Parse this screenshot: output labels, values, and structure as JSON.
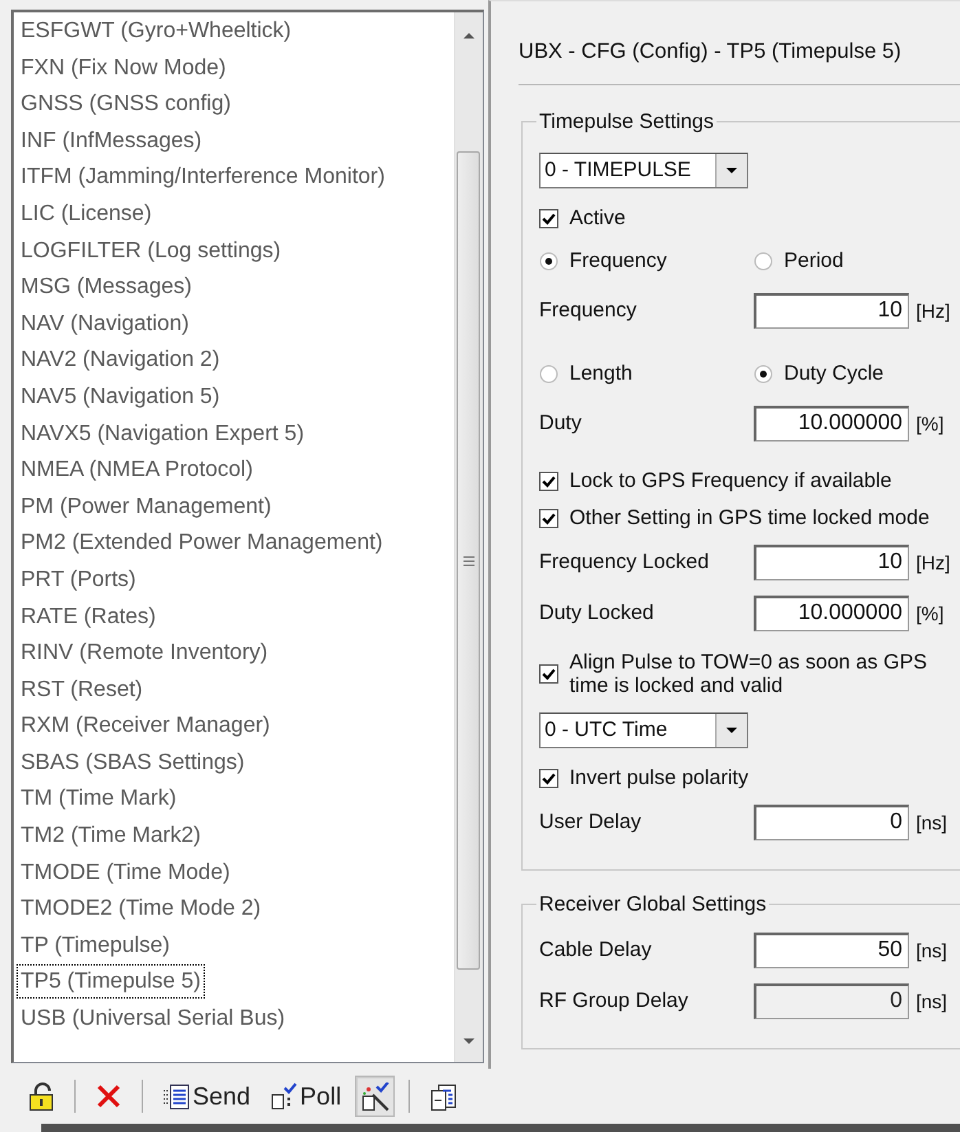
{
  "message_list": {
    "items": [
      {
        "label": "ESFGWT (Gyro+Wheeltick)",
        "selected": false
      },
      {
        "label": "FXN (Fix Now Mode)",
        "selected": false
      },
      {
        "label": "GNSS (GNSS config)",
        "selected": false
      },
      {
        "label": "INF (InfMessages)",
        "selected": false
      },
      {
        "label": "ITFM (Jamming/Interference Monitor)",
        "selected": false
      },
      {
        "label": "LIC (License)",
        "selected": false
      },
      {
        "label": "LOGFILTER (Log settings)",
        "selected": false
      },
      {
        "label": "MSG (Messages)",
        "selected": false
      },
      {
        "label": "NAV (Navigation)",
        "selected": false
      },
      {
        "label": "NAV2 (Navigation 2)",
        "selected": false
      },
      {
        "label": "NAV5 (Navigation 5)",
        "selected": false
      },
      {
        "label": "NAVX5 (Navigation Expert 5)",
        "selected": false
      },
      {
        "label": "NMEA (NMEA Protocol)",
        "selected": false
      },
      {
        "label": "PM (Power Management)",
        "selected": false
      },
      {
        "label": "PM2 (Extended Power Management)",
        "selected": false
      },
      {
        "label": "PRT (Ports)",
        "selected": false
      },
      {
        "label": "RATE (Rates)",
        "selected": false
      },
      {
        "label": "RINV (Remote Inventory)",
        "selected": false
      },
      {
        "label": "RST (Reset)",
        "selected": false
      },
      {
        "label": "RXM (Receiver Manager)",
        "selected": false
      },
      {
        "label": "SBAS (SBAS Settings)",
        "selected": false
      },
      {
        "label": "TM (Time Mark)",
        "selected": false
      },
      {
        "label": "TM2 (Time Mark2)",
        "selected": false
      },
      {
        "label": "TMODE (Time Mode)",
        "selected": false
      },
      {
        "label": "TMODE2 (Time Mode 2)",
        "selected": false
      },
      {
        "label": "TP (Timepulse)",
        "selected": false
      },
      {
        "label": "TP5 (Timepulse 5)",
        "selected": true
      },
      {
        "label": "USB (Universal Serial Bus)",
        "selected": false
      }
    ]
  },
  "toolbar": {
    "buttons": [
      {
        "kind": "lock",
        "pressed": false
      },
      {
        "kind": "separator"
      },
      {
        "kind": "delete",
        "pressed": false
      },
      {
        "kind": "separator"
      },
      {
        "kind": "send",
        "label": "Send",
        "pressed": false
      },
      {
        "kind": "poll",
        "label": "Poll",
        "pressed": false
      },
      {
        "kind": "autopoll",
        "pressed": true
      },
      {
        "kind": "separator"
      },
      {
        "kind": "export",
        "pressed": false
      }
    ]
  },
  "panel": {
    "title": "UBX - CFG (Config) - TP5 (Timepulse 5)",
    "groups": [
      {
        "title": "Timepulse Settings",
        "rows": [
          {
            "kind": "select",
            "value": "0 - TIMEPULSE"
          },
          {
            "kind": "check",
            "label": "Active",
            "checked": true
          },
          {
            "kind": "radios",
            "options": [
              {
                "label": "Frequency",
                "selected": true
              },
              {
                "label": "Period",
                "selected": false
              }
            ]
          },
          {
            "kind": "field",
            "label": "Frequency",
            "value": "10",
            "unit": "[Hz]",
            "disabled": false
          },
          {
            "kind": "radios",
            "options": [
              {
                "label": "Length",
                "selected": false
              },
              {
                "label": "Duty Cycle",
                "selected": true
              }
            ]
          },
          {
            "kind": "field",
            "label": "Duty",
            "value": "10.000000",
            "unit": "[%]",
            "disabled": false
          },
          {
            "kind": "check",
            "label": "Lock to GPS Frequency if available",
            "checked": true
          },
          {
            "kind": "check",
            "label": "Other Setting in GPS time locked mode",
            "checked": true
          },
          {
            "kind": "field",
            "label": "Frequency Locked",
            "value": "10",
            "unit": "[Hz]",
            "disabled": false
          },
          {
            "kind": "field",
            "label": "Duty Locked",
            "value": "10.000000",
            "unit": "[%]",
            "disabled": false
          },
          {
            "kind": "check",
            "label": "Align Pulse to TOW=0 as soon as GPS time is locked and valid",
            "checked": true
          },
          {
            "kind": "select",
            "value": "0 - UTC Time"
          },
          {
            "kind": "check",
            "label": "Invert pulse polarity",
            "checked": true
          },
          {
            "kind": "field",
            "label": "User Delay",
            "value": "0",
            "unit": "[ns]",
            "disabled": false
          }
        ]
      },
      {
        "title": "Receiver Global Settings",
        "rows": [
          {
            "kind": "field",
            "label": "Cable Delay",
            "value": "50",
            "unit": "[ns]",
            "disabled": false
          },
          {
            "kind": "field",
            "label": "RF Group Delay",
            "value": "0",
            "unit": "[ns]",
            "disabled": true
          }
        ]
      }
    ]
  }
}
